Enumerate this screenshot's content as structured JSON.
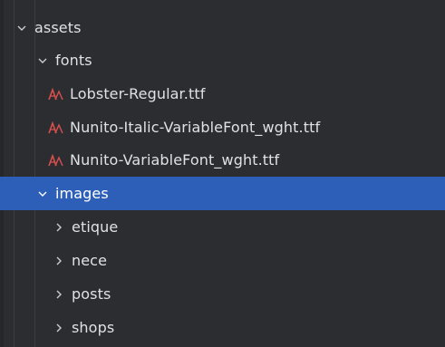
{
  "tree": {
    "items": [
      {
        "label": "assets",
        "kind": "folder",
        "expanded": true,
        "level": 0,
        "icon": "chevron-down-icon"
      },
      {
        "label": "fonts",
        "kind": "folder",
        "expanded": true,
        "level": 1,
        "icon": "chevron-down-icon"
      },
      {
        "label": "Lobster-Regular.ttf",
        "kind": "font-file",
        "level": 2,
        "icon": "font-file-icon"
      },
      {
        "label": "Nunito-Italic-VariableFont_wght.ttf",
        "kind": "font-file",
        "level": 2,
        "icon": "font-file-icon"
      },
      {
        "label": "Nunito-VariableFont_wght.ttf",
        "kind": "font-file",
        "level": 2,
        "icon": "font-file-icon"
      },
      {
        "label": "images",
        "kind": "folder",
        "expanded": true,
        "selected": true,
        "level": 1,
        "icon": "chevron-down-icon"
      },
      {
        "label": "etique",
        "kind": "folder",
        "expanded": false,
        "level": 2,
        "icon": "chevron-right-icon"
      },
      {
        "label": "nece",
        "kind": "folder",
        "expanded": false,
        "level": 2,
        "icon": "chevron-right-icon"
      },
      {
        "label": "posts",
        "kind": "folder",
        "expanded": false,
        "level": 2,
        "icon": "chevron-right-icon"
      },
      {
        "label": "shops",
        "kind": "folder",
        "expanded": false,
        "level": 2,
        "icon": "chevron-right-icon"
      }
    ]
  },
  "colors": {
    "background": "#2b2d30",
    "selection": "#2e5fb8",
    "text": "#dfe1e5",
    "font_icon": "#d94f4f"
  }
}
